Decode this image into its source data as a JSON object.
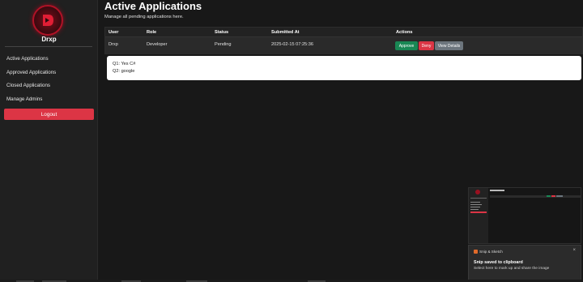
{
  "sidebar": {
    "brand": "Drxp",
    "items": [
      {
        "label": "Active Applications"
      },
      {
        "label": "Approved Applications"
      },
      {
        "label": "Closed Applications"
      },
      {
        "label": "Manage Admins"
      }
    ],
    "logout_label": "Logout"
  },
  "main": {
    "title": "Active Applications",
    "subtitle": "Manage all pending applications here.",
    "table": {
      "headers": [
        "User",
        "Role",
        "Status",
        "Submitted At",
        "Actions"
      ],
      "rows": [
        {
          "user": "Drxp",
          "role": "Developer",
          "status": "Pending",
          "submitted_at": "2025-02-15 07:25:36",
          "actions": {
            "approve": "Approve",
            "deny": "Deny",
            "view": "View Details"
          }
        }
      ]
    },
    "details": {
      "lines": [
        "Q1: Yes C#",
        "Q2: google"
      ]
    }
  },
  "notification": {
    "app": "Snip & Sketch",
    "close_glyph": "×",
    "title": "Snip saved to clipboard",
    "message": "Select here to mark up and share the image"
  },
  "colors": {
    "accent_red": "#dc3545",
    "approve_green": "#198754",
    "view_gray": "#6c757d",
    "logo_ring": "#b01226"
  },
  "icons": {
    "logo": "drxp-logo-icon",
    "toast_app": "snip-sketch-icon",
    "close": "close-icon"
  }
}
